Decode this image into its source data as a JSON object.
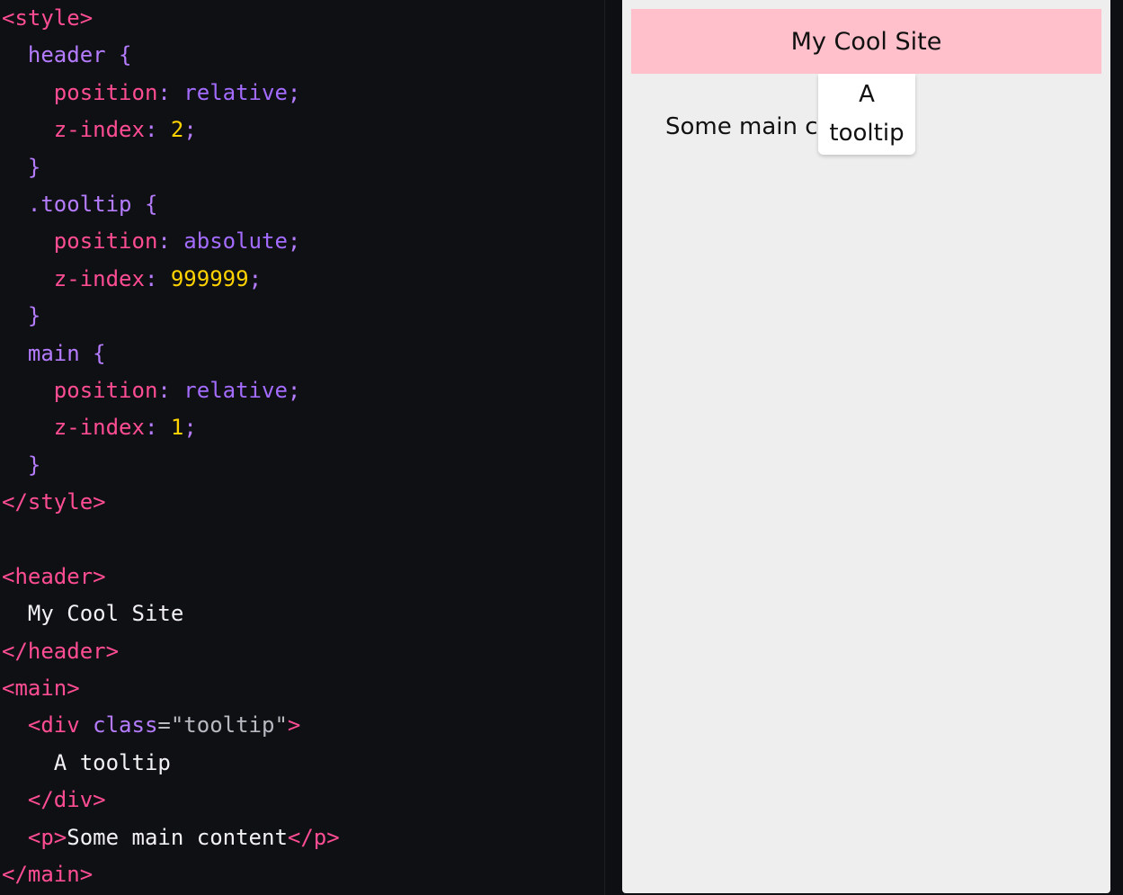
{
  "editor": {
    "lines": [
      [
        {
          "c": "t-tag",
          "t": "<style>"
        }
      ],
      [
        {
          "c": "t-text",
          "t": "  "
        },
        {
          "c": "t-sel",
          "t": "header"
        },
        {
          "c": "t-punc",
          "t": " {"
        }
      ],
      [
        {
          "c": "t-text",
          "t": "    "
        },
        {
          "c": "t-prop",
          "t": "position"
        },
        {
          "c": "t-punc",
          "t": ": "
        },
        {
          "c": "t-val",
          "t": "relative"
        },
        {
          "c": "t-punc",
          "t": ";"
        }
      ],
      [
        {
          "c": "t-text",
          "t": "    "
        },
        {
          "c": "t-prop",
          "t": "z-index"
        },
        {
          "c": "t-punc",
          "t": ": "
        },
        {
          "c": "t-num",
          "t": "2"
        },
        {
          "c": "t-punc",
          "t": ";"
        }
      ],
      [
        {
          "c": "t-text",
          "t": "  "
        },
        {
          "c": "t-punc",
          "t": "}"
        }
      ],
      [
        {
          "c": "t-text",
          "t": "  "
        },
        {
          "c": "t-sel",
          "t": ".tooltip"
        },
        {
          "c": "t-punc",
          "t": " {"
        }
      ],
      [
        {
          "c": "t-text",
          "t": "    "
        },
        {
          "c": "t-prop",
          "t": "position"
        },
        {
          "c": "t-punc",
          "t": ": "
        },
        {
          "c": "t-val",
          "t": "absolute"
        },
        {
          "c": "t-punc",
          "t": ";"
        }
      ],
      [
        {
          "c": "t-text",
          "t": "    "
        },
        {
          "c": "t-prop",
          "t": "z-index"
        },
        {
          "c": "t-punc",
          "t": ": "
        },
        {
          "c": "t-num",
          "t": "999999"
        },
        {
          "c": "t-punc",
          "t": ";"
        }
      ],
      [
        {
          "c": "t-text",
          "t": "  "
        },
        {
          "c": "t-punc",
          "t": "}"
        }
      ],
      [
        {
          "c": "t-text",
          "t": "  "
        },
        {
          "c": "t-sel",
          "t": "main"
        },
        {
          "c": "t-punc",
          "t": " {"
        }
      ],
      [
        {
          "c": "t-text",
          "t": "    "
        },
        {
          "c": "t-prop",
          "t": "position"
        },
        {
          "c": "t-punc",
          "t": ": "
        },
        {
          "c": "t-val",
          "t": "relative"
        },
        {
          "c": "t-punc",
          "t": ";"
        }
      ],
      [
        {
          "c": "t-text",
          "t": "    "
        },
        {
          "c": "t-prop",
          "t": "z-index"
        },
        {
          "c": "t-punc",
          "t": ": "
        },
        {
          "c": "t-num",
          "t": "1"
        },
        {
          "c": "t-punc",
          "t": ";"
        }
      ],
      [
        {
          "c": "t-text",
          "t": "  "
        },
        {
          "c": "t-punc",
          "t": "}"
        }
      ],
      [
        {
          "c": "t-tag",
          "t": "</style>"
        }
      ],
      [],
      [
        {
          "c": "t-tag",
          "t": "<header>"
        }
      ],
      [
        {
          "c": "t-text",
          "t": "  My Cool Site"
        }
      ],
      [
        {
          "c": "t-tag",
          "t": "</header>"
        }
      ],
      [
        {
          "c": "t-tag",
          "t": "<main>"
        }
      ],
      [
        {
          "c": "t-text",
          "t": "  "
        },
        {
          "c": "t-tag",
          "t": "<div "
        },
        {
          "c": "t-attr",
          "t": "class"
        },
        {
          "c": "t-str",
          "t": "=\"tooltip\""
        },
        {
          "c": "t-tag",
          "t": ">"
        }
      ],
      [
        {
          "c": "t-text",
          "t": "    A tooltip"
        }
      ],
      [
        {
          "c": "t-text",
          "t": "  "
        },
        {
          "c": "t-tag",
          "t": "</div>"
        }
      ],
      [
        {
          "c": "t-text",
          "t": "  "
        },
        {
          "c": "t-tag",
          "t": "<p>"
        },
        {
          "c": "t-text",
          "t": "Some main content"
        },
        {
          "c": "t-tag",
          "t": "</p>"
        }
      ],
      [
        {
          "c": "t-tag",
          "t": "</main>"
        }
      ]
    ]
  },
  "preview": {
    "header_text": "My Cool Site",
    "tooltip_line1": "A",
    "tooltip_line2": "tooltip",
    "main_text": "Some main c"
  },
  "colors": {
    "editor_bg": "#0f1014",
    "tag": "#ff4d94",
    "selector": "#b57cff",
    "number": "#ffd200",
    "preview_bg": "#eeeeee",
    "header_bg": "#ffc0cb",
    "tooltip_bg": "#ffffff"
  }
}
